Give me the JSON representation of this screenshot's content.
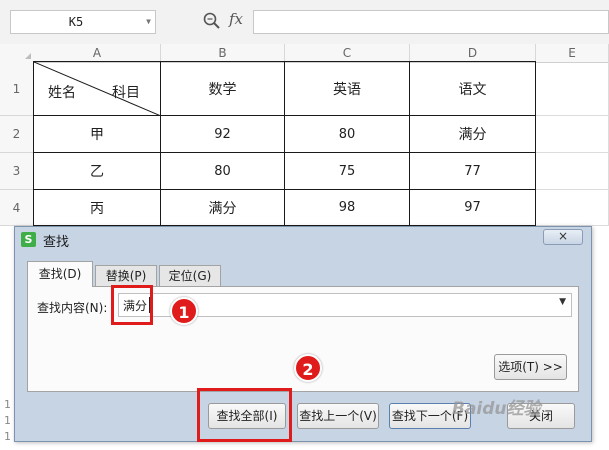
{
  "formula_bar": {
    "cell_ref": "K5",
    "fx": "fx"
  },
  "columns": [
    "A",
    "B",
    "C",
    "D",
    "E"
  ],
  "rows": [
    "1",
    "2",
    "3",
    "4"
  ],
  "table": {
    "header_name": "姓名",
    "header_subject": "科目",
    "subjects": [
      "数学",
      "英语",
      "语文"
    ],
    "data": [
      [
        "甲",
        "92",
        "80",
        "满分"
      ],
      [
        "乙",
        "80",
        "75",
        "77"
      ],
      [
        "丙",
        "满分",
        "98",
        "97"
      ]
    ]
  },
  "dialog": {
    "app_icon": "S",
    "title": "查找",
    "close_icon": "×",
    "tabs": [
      "查找(D)",
      "替换(P)",
      "定位(G)"
    ],
    "find_label": "查找内容(N):",
    "find_value": "满分",
    "options_button": "选项(T) >>",
    "buttons": {
      "find_all": "查找全部(I)",
      "find_prev": "查找上一个(V)",
      "find_next": "查找下一个(F)",
      "close": "关闭"
    }
  },
  "annotations": {
    "step1": "1",
    "step2": "2"
  },
  "watermark": "Baidu经验",
  "colors": {
    "annotation_red": "#e01b1b",
    "dialog_bg": "#c7d4e4",
    "wps_green": "#3fae49"
  }
}
